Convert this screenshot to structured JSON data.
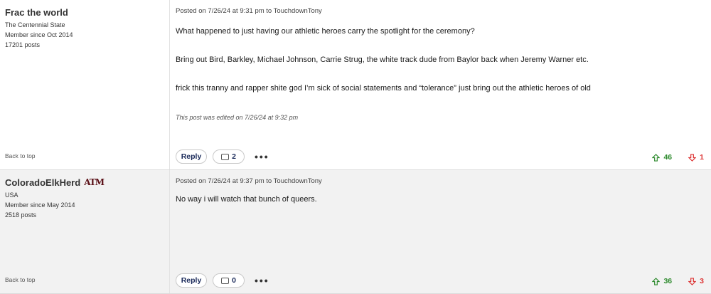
{
  "posts": [
    {
      "username": "Frac the world",
      "badge": "",
      "location": "The Centennial State",
      "member_since": "Member since Oct 2014",
      "post_count": "17201 posts",
      "posted": "Posted on 7/26/24 at 9:31 pm to TouchdownTony",
      "paragraphs": [
        "What happened to just having our athletic heroes carry the spotlight for the ceremony?",
        "Bring out Bird, Barkley, Michael Johnson, Carrie Strug, the white track dude from Baylor back when Jeremy Warner etc.",
        "frick this tranny and rapper shite god I’m sick of social statements and “tolerance” just bring out the athletic heroes of old"
      ],
      "edited": "This post was edited on 7/26/24 at 9:32 pm",
      "back_to_top": "Back to top",
      "reply_label": "Reply",
      "comment_count": "2",
      "more": "•••",
      "upvotes": "46",
      "downvotes": "1"
    },
    {
      "username": "ColoradoElkHerd",
      "badge": "ATM",
      "location": "USA",
      "member_since": "Member since May 2014",
      "post_count": "2518 posts",
      "posted": "Posted on 7/26/24 at 9:37 pm to TouchdownTony",
      "paragraphs": [
        "No way i will watch that bunch of queers."
      ],
      "edited": "",
      "back_to_top": "Back to top",
      "reply_label": "Reply",
      "comment_count": "0",
      "more": "•••",
      "upvotes": "36",
      "downvotes": "3"
    }
  ],
  "colors": {
    "upvote": "#2e8b2e",
    "downvote": "#dd3333",
    "badge": "#5a0f16"
  },
  "icons": {
    "comment": "comment-bubble-icon",
    "upvote": "thumbs-up-arrow-icon",
    "downvote": "thumbs-down-arrow-icon",
    "more": "more-dots-icon"
  }
}
